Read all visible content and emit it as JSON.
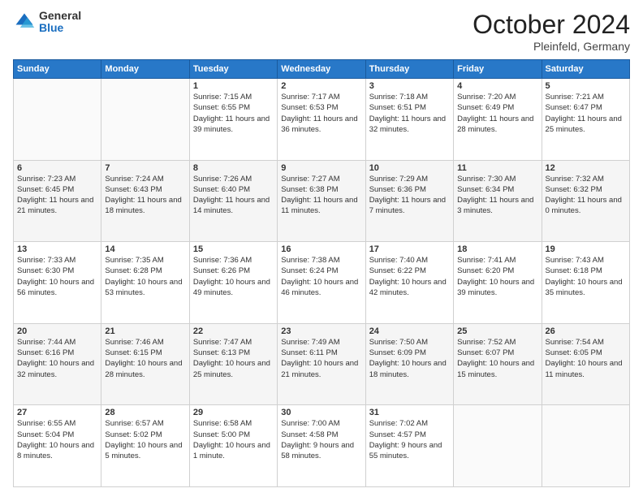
{
  "header": {
    "logo_general": "General",
    "logo_blue": "Blue",
    "month_title": "October 2024",
    "location": "Pleinfeld, Germany"
  },
  "weekdays": [
    "Sunday",
    "Monday",
    "Tuesday",
    "Wednesday",
    "Thursday",
    "Friday",
    "Saturday"
  ],
  "weeks": [
    [
      {
        "day": "",
        "sunrise": "",
        "sunset": "",
        "daylight": ""
      },
      {
        "day": "",
        "sunrise": "",
        "sunset": "",
        "daylight": ""
      },
      {
        "day": "1",
        "sunrise": "Sunrise: 7:15 AM",
        "sunset": "Sunset: 6:55 PM",
        "daylight": "Daylight: 11 hours and 39 minutes."
      },
      {
        "day": "2",
        "sunrise": "Sunrise: 7:17 AM",
        "sunset": "Sunset: 6:53 PM",
        "daylight": "Daylight: 11 hours and 36 minutes."
      },
      {
        "day": "3",
        "sunrise": "Sunrise: 7:18 AM",
        "sunset": "Sunset: 6:51 PM",
        "daylight": "Daylight: 11 hours and 32 minutes."
      },
      {
        "day": "4",
        "sunrise": "Sunrise: 7:20 AM",
        "sunset": "Sunset: 6:49 PM",
        "daylight": "Daylight: 11 hours and 28 minutes."
      },
      {
        "day": "5",
        "sunrise": "Sunrise: 7:21 AM",
        "sunset": "Sunset: 6:47 PM",
        "daylight": "Daylight: 11 hours and 25 minutes."
      }
    ],
    [
      {
        "day": "6",
        "sunrise": "Sunrise: 7:23 AM",
        "sunset": "Sunset: 6:45 PM",
        "daylight": "Daylight: 11 hours and 21 minutes."
      },
      {
        "day": "7",
        "sunrise": "Sunrise: 7:24 AM",
        "sunset": "Sunset: 6:43 PM",
        "daylight": "Daylight: 11 hours and 18 minutes."
      },
      {
        "day": "8",
        "sunrise": "Sunrise: 7:26 AM",
        "sunset": "Sunset: 6:40 PM",
        "daylight": "Daylight: 11 hours and 14 minutes."
      },
      {
        "day": "9",
        "sunrise": "Sunrise: 7:27 AM",
        "sunset": "Sunset: 6:38 PM",
        "daylight": "Daylight: 11 hours and 11 minutes."
      },
      {
        "day": "10",
        "sunrise": "Sunrise: 7:29 AM",
        "sunset": "Sunset: 6:36 PM",
        "daylight": "Daylight: 11 hours and 7 minutes."
      },
      {
        "day": "11",
        "sunrise": "Sunrise: 7:30 AM",
        "sunset": "Sunset: 6:34 PM",
        "daylight": "Daylight: 11 hours and 3 minutes."
      },
      {
        "day": "12",
        "sunrise": "Sunrise: 7:32 AM",
        "sunset": "Sunset: 6:32 PM",
        "daylight": "Daylight: 11 hours and 0 minutes."
      }
    ],
    [
      {
        "day": "13",
        "sunrise": "Sunrise: 7:33 AM",
        "sunset": "Sunset: 6:30 PM",
        "daylight": "Daylight: 10 hours and 56 minutes."
      },
      {
        "day": "14",
        "sunrise": "Sunrise: 7:35 AM",
        "sunset": "Sunset: 6:28 PM",
        "daylight": "Daylight: 10 hours and 53 minutes."
      },
      {
        "day": "15",
        "sunrise": "Sunrise: 7:36 AM",
        "sunset": "Sunset: 6:26 PM",
        "daylight": "Daylight: 10 hours and 49 minutes."
      },
      {
        "day": "16",
        "sunrise": "Sunrise: 7:38 AM",
        "sunset": "Sunset: 6:24 PM",
        "daylight": "Daylight: 10 hours and 46 minutes."
      },
      {
        "day": "17",
        "sunrise": "Sunrise: 7:40 AM",
        "sunset": "Sunset: 6:22 PM",
        "daylight": "Daylight: 10 hours and 42 minutes."
      },
      {
        "day": "18",
        "sunrise": "Sunrise: 7:41 AM",
        "sunset": "Sunset: 6:20 PM",
        "daylight": "Daylight: 10 hours and 39 minutes."
      },
      {
        "day": "19",
        "sunrise": "Sunrise: 7:43 AM",
        "sunset": "Sunset: 6:18 PM",
        "daylight": "Daylight: 10 hours and 35 minutes."
      }
    ],
    [
      {
        "day": "20",
        "sunrise": "Sunrise: 7:44 AM",
        "sunset": "Sunset: 6:16 PM",
        "daylight": "Daylight: 10 hours and 32 minutes."
      },
      {
        "day": "21",
        "sunrise": "Sunrise: 7:46 AM",
        "sunset": "Sunset: 6:15 PM",
        "daylight": "Daylight: 10 hours and 28 minutes."
      },
      {
        "day": "22",
        "sunrise": "Sunrise: 7:47 AM",
        "sunset": "Sunset: 6:13 PM",
        "daylight": "Daylight: 10 hours and 25 minutes."
      },
      {
        "day": "23",
        "sunrise": "Sunrise: 7:49 AM",
        "sunset": "Sunset: 6:11 PM",
        "daylight": "Daylight: 10 hours and 21 minutes."
      },
      {
        "day": "24",
        "sunrise": "Sunrise: 7:50 AM",
        "sunset": "Sunset: 6:09 PM",
        "daylight": "Daylight: 10 hours and 18 minutes."
      },
      {
        "day": "25",
        "sunrise": "Sunrise: 7:52 AM",
        "sunset": "Sunset: 6:07 PM",
        "daylight": "Daylight: 10 hours and 15 minutes."
      },
      {
        "day": "26",
        "sunrise": "Sunrise: 7:54 AM",
        "sunset": "Sunset: 6:05 PM",
        "daylight": "Daylight: 10 hours and 11 minutes."
      }
    ],
    [
      {
        "day": "27",
        "sunrise": "Sunrise: 6:55 AM",
        "sunset": "Sunset: 5:04 PM",
        "daylight": "Daylight: 10 hours and 8 minutes."
      },
      {
        "day": "28",
        "sunrise": "Sunrise: 6:57 AM",
        "sunset": "Sunset: 5:02 PM",
        "daylight": "Daylight: 10 hours and 5 minutes."
      },
      {
        "day": "29",
        "sunrise": "Sunrise: 6:58 AM",
        "sunset": "Sunset: 5:00 PM",
        "daylight": "Daylight: 10 hours and 1 minute."
      },
      {
        "day": "30",
        "sunrise": "Sunrise: 7:00 AM",
        "sunset": "Sunset: 4:58 PM",
        "daylight": "Daylight: 9 hours and 58 minutes."
      },
      {
        "day": "31",
        "sunrise": "Sunrise: 7:02 AM",
        "sunset": "Sunset: 4:57 PM",
        "daylight": "Daylight: 9 hours and 55 minutes."
      },
      {
        "day": "",
        "sunrise": "",
        "sunset": "",
        "daylight": ""
      },
      {
        "day": "",
        "sunrise": "",
        "sunset": "",
        "daylight": ""
      }
    ]
  ]
}
